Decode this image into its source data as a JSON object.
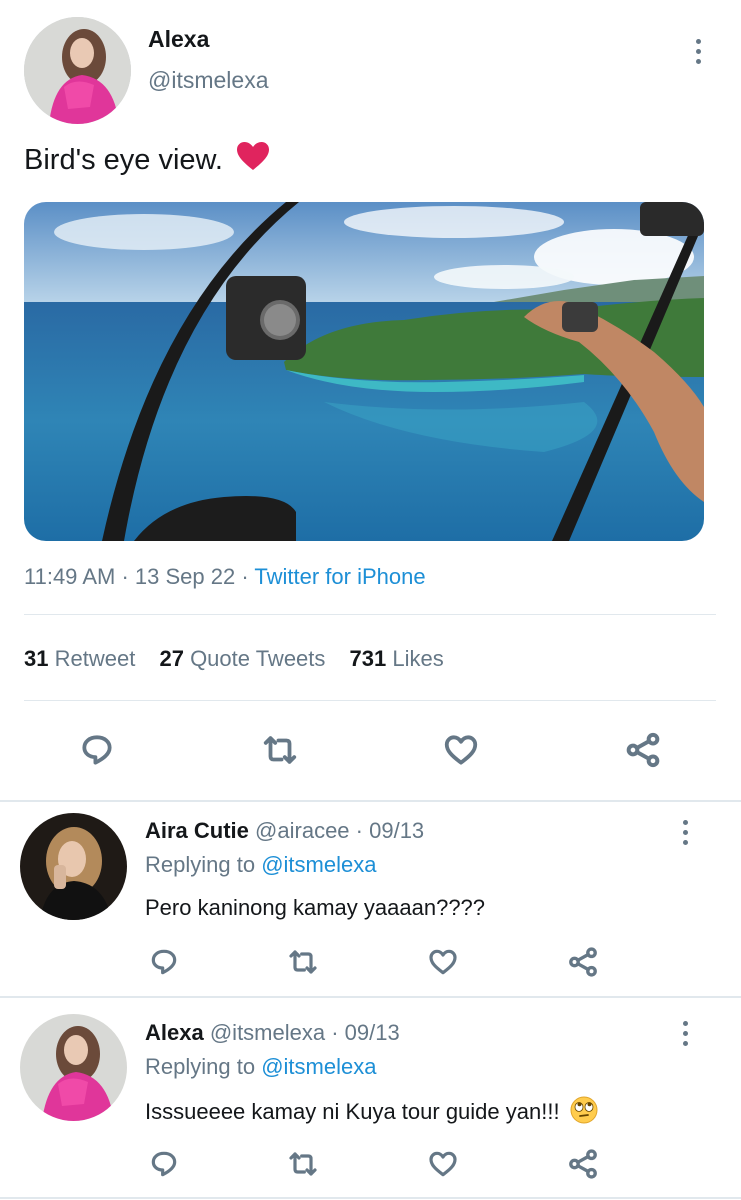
{
  "tweet": {
    "author_name": "Alexa",
    "author_handle": "@itsmelexa",
    "text": "Bird's eye view.",
    "text_emoji": "❤️",
    "time": "11:49 AM",
    "date": "13 Sep 22",
    "source": "Twitter for iPhone",
    "separator": "·",
    "stats": {
      "retweets_count": "31",
      "retweets_label": "Retweet",
      "quotes_count": "27",
      "quotes_label": "Quote Tweets",
      "likes_count": "731",
      "likes_label": "Likes"
    }
  },
  "replies": [
    {
      "name": "Aira Cutie",
      "handle": "@airacee",
      "date": "· 09/13",
      "replying_prefix": "Replying to",
      "replying_to": "@itsmelexa",
      "text": "Pero kaninong kamay yaaaan????"
    },
    {
      "name": "Alexa",
      "handle": "@itsmelexa",
      "date": "· 09/13",
      "replying_prefix": "Replying to",
      "replying_to": "@itsmelexa",
      "text": "Isssueeee kamay ni Kuya tour guide yan!!!",
      "emoji": "🙄"
    }
  ],
  "icons": [
    "more-vertical-icon",
    "reply-icon",
    "retweet-icon",
    "like-icon",
    "share-icon"
  ],
  "colors": {
    "link": "#1d8fd6",
    "muted": "#657786",
    "divider": "#e1e8ed",
    "heart": "#e0245e"
  }
}
